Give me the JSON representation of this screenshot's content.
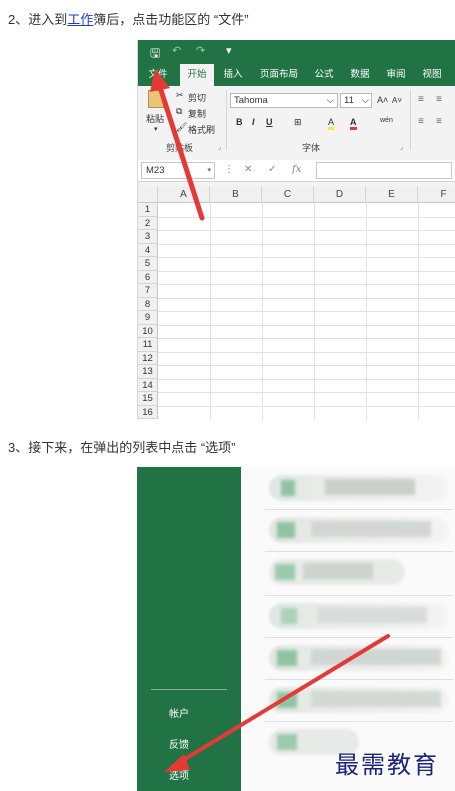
{
  "step2": {
    "prefix": "2、进入到",
    "link": "工作",
    "suffix": "簿后，点击功能区的 “文件”"
  },
  "step3": {
    "text": "3、接下来，在弹出的列表中点击 “选项”"
  },
  "excel": {
    "quick_access": {
      "save": "🖫",
      "undo": "↶",
      "redo": "↷",
      "customize": "▾"
    },
    "tabs": [
      "文件",
      "开始",
      "插入",
      "页面布局",
      "公式",
      "数据",
      "审阅",
      "视图"
    ],
    "active_tab": "开始",
    "clipboard": {
      "paste": "粘贴",
      "cut": "剪切",
      "copy": "复制",
      "format_painter": "格式刷",
      "group_label": "剪贴板"
    },
    "font": {
      "name": "Tahoma",
      "size": "11",
      "grow": "A˄",
      "shrink": "A˅",
      "bold": "B",
      "italic": "I",
      "underline": "U",
      "border": "⊞",
      "fill": "A",
      "color": "A",
      "phonetic": "wén",
      "group_label": "字体"
    },
    "name_box": "M23",
    "formula_icons": {
      "cancel": "✕",
      "enter": "✓",
      "fx": "fx"
    },
    "columns": [
      "A",
      "B",
      "C",
      "D",
      "E",
      "F"
    ],
    "rows": [
      "1",
      "2",
      "3",
      "4",
      "5",
      "6",
      "7",
      "8",
      "9",
      "10",
      "11",
      "12",
      "13",
      "14",
      "15",
      "16"
    ]
  },
  "backstage": {
    "items": [
      "帐户",
      "反馈",
      "选项"
    ]
  },
  "watermark": "最需教育",
  "colors": {
    "excel_green": "#217346",
    "arrow_red": "#e53935",
    "link_blue": "#1a3bd4"
  }
}
